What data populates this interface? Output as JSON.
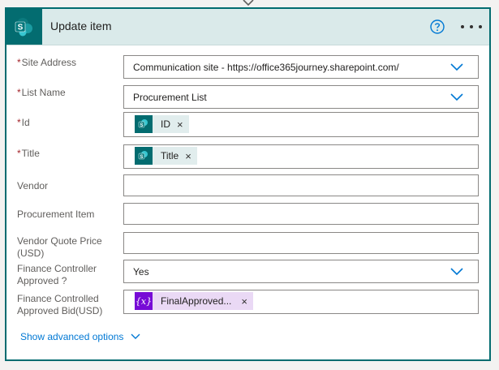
{
  "action": {
    "title": "Update item",
    "app_icon": "sharepoint-icon",
    "help_icon": "help-circle-icon",
    "more_icon": "ellipsis-icon"
  },
  "fields": {
    "site_address": {
      "label": "Site Address",
      "required": "*",
      "value": "Communication site - https://office365journey.sharepoint.com/"
    },
    "list_name": {
      "label": "List Name",
      "required": "*",
      "value": "Procurement List"
    },
    "id": {
      "label": "Id",
      "required": "*",
      "token": "ID"
    },
    "title": {
      "label": "Title",
      "required": "*",
      "token": "Title"
    },
    "vendor": {
      "label": "Vendor",
      "value": ""
    },
    "procurement_item": {
      "label": "Procurement Item",
      "value": ""
    },
    "vendor_quote_price": {
      "label": "Vendor Quote Price (USD)",
      "value": ""
    },
    "finance_controller_approved": {
      "label": "Finance Controller Approved ?",
      "value": "Yes"
    },
    "finance_controlled_approved_bid": {
      "label": "Finance Controlled Approved Bid(USD)",
      "token": "FinalApproved..."
    }
  },
  "token_remove": "×",
  "expression_icon_text": "{x}",
  "advanced_options": "Show advanced options",
  "colors": {
    "accent": "#036c70",
    "header_bg": "#daeaea",
    "link": "#0078d4",
    "required": "#a4262c",
    "expression": "#770bd6"
  }
}
